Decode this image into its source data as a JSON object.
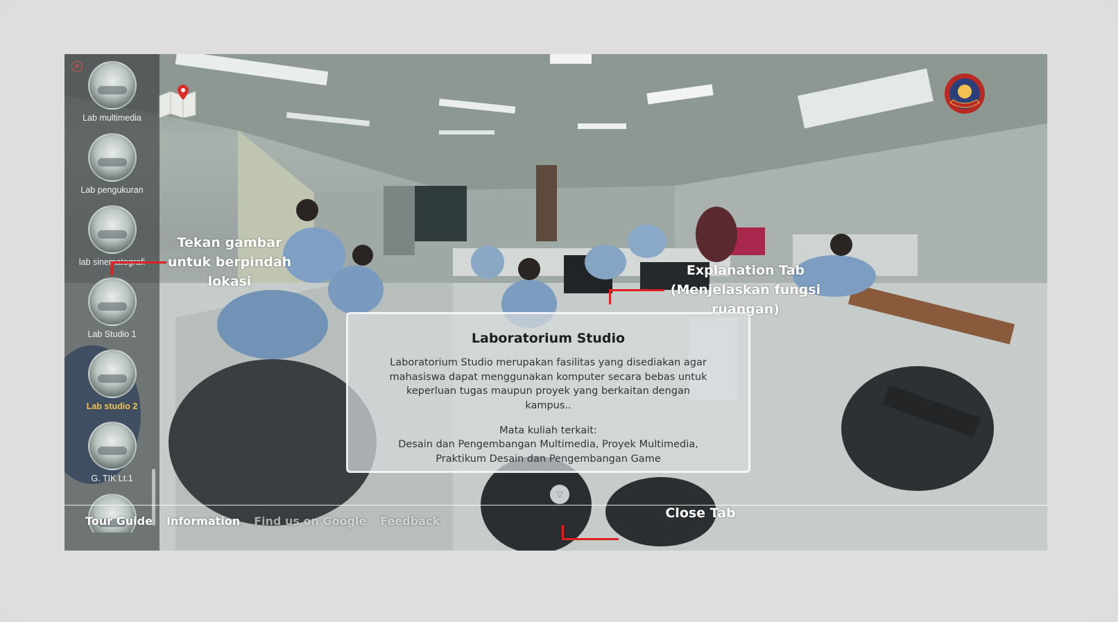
{
  "sidebar": {
    "close_icon": "close-circle-icon",
    "items": [
      {
        "label": "Lab multimedia",
        "active": false
      },
      {
        "label": "Lab pengukuran",
        "active": false
      },
      {
        "label": "lab sinematografi",
        "active": false
      },
      {
        "label": "Lab Studio 1",
        "active": false
      },
      {
        "label": "Lab studio 2",
        "active": true
      },
      {
        "label": "G. TIK Lt.1",
        "active": false
      },
      {
        "label": "",
        "active": false
      }
    ]
  },
  "icons": {
    "map": "map-pin-icon",
    "logo": "university-emblem-icon"
  },
  "panel": {
    "title": "Laboratorium Studio",
    "description": "Laboratorium Studio merupakan fasilitas yang disediakan agar mahasiswa dapat menggunakan komputer secara bebas untuk keperluan tugas maupun proyek yang berkaitan dengan kampus..",
    "courses_title": "Mata kuliah terkait:",
    "courses": "Desain dan Pengembangan Multimedia, Proyek Multimedia, Praktikum Desain dan Pengembangan Game"
  },
  "close_tab_icon": "triangle-down-icon",
  "nav": {
    "tour_guide": "Tour Guide",
    "information": "Information",
    "find_google": "Find us on Google",
    "feedback": "Feedback"
  },
  "annotations": {
    "thumbs_line1": "Tekan gambar",
    "thumbs_line2": "untuk berpindah",
    "thumbs_line3": "lokasi",
    "explain_line1": "Explanation Tab",
    "explain_line2": "(Menjelaskan fungsi",
    "explain_line3": "ruangan)",
    "close_tab": "Close Tab"
  },
  "colors": {
    "accent_active": "#f2c14e",
    "annotation_line": "#e02020"
  }
}
